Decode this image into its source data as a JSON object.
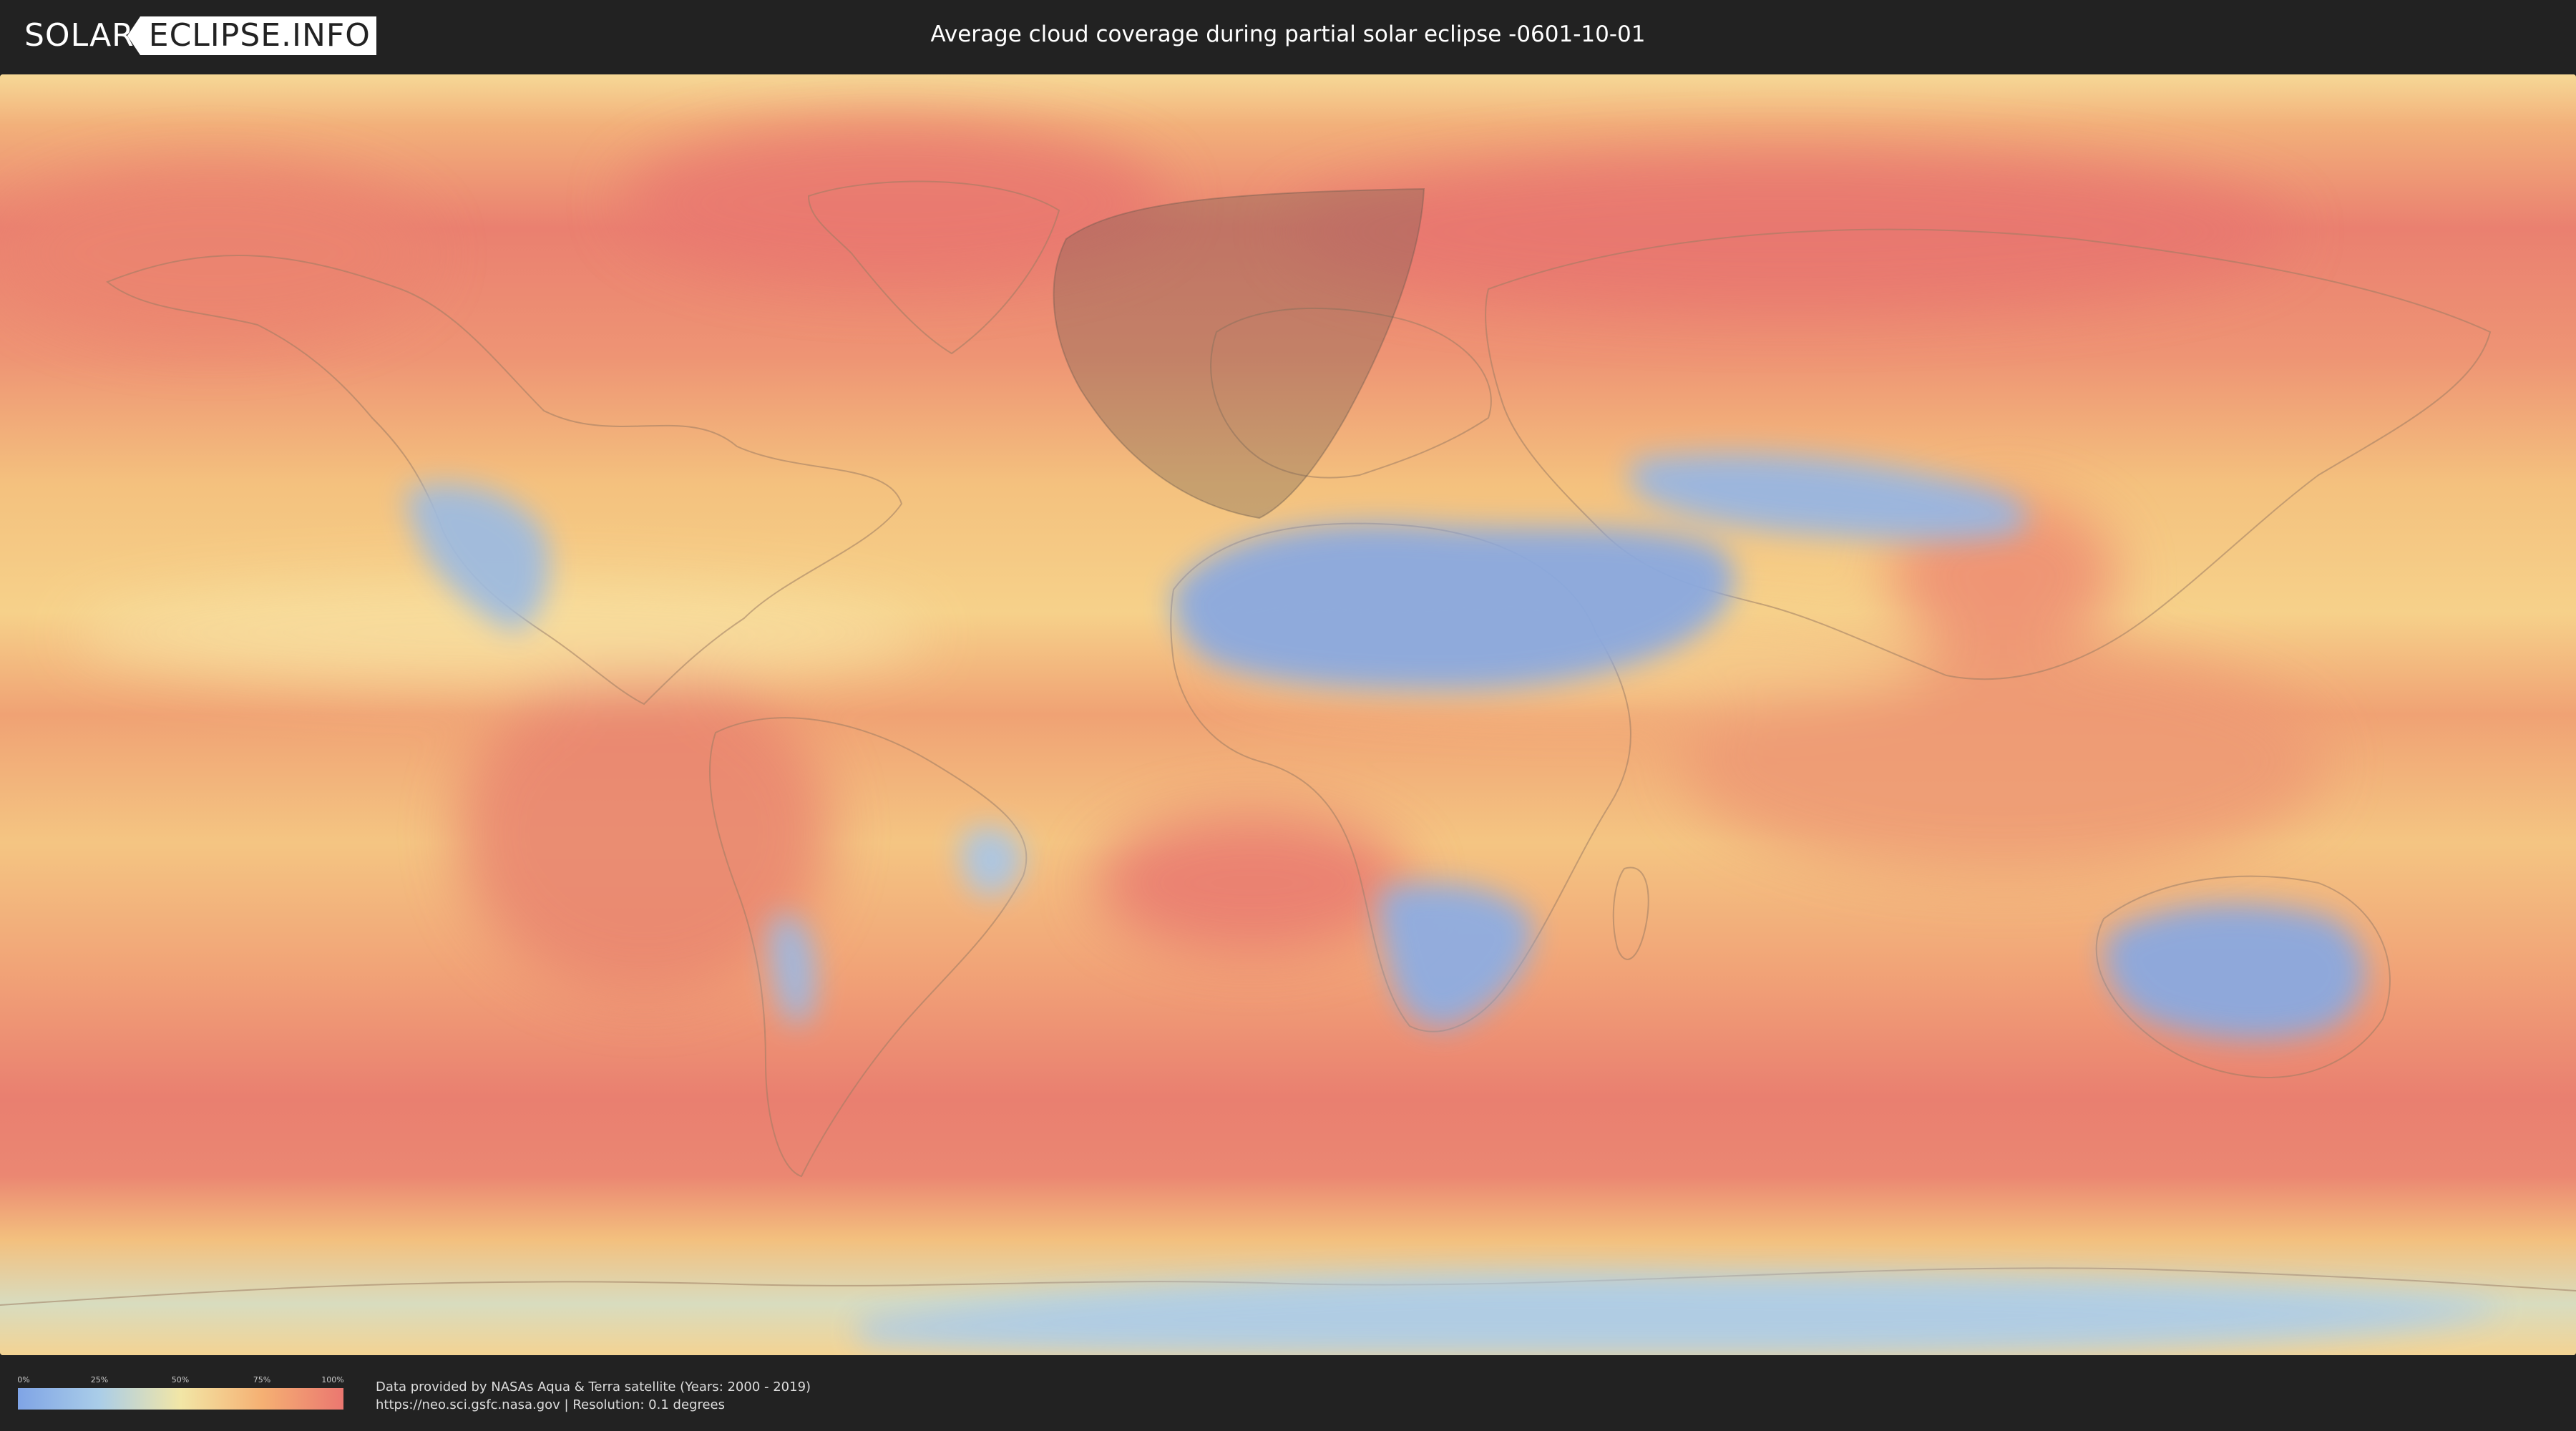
{
  "header": {
    "logo_left": "SOLAR",
    "logo_right": "ECLIPSE.INFO",
    "title": "Average cloud coverage during partial solar eclipse -0601-10-01"
  },
  "legend": {
    "ticks": [
      "0%",
      "25%",
      "50%",
      "75%",
      "100%"
    ],
    "colors": [
      "#7fa4e6",
      "#aacde8",
      "#f2e6a6",
      "#f5b073",
      "#eb7770"
    ]
  },
  "credits": {
    "line1": "Data provided by NASAs Aqua & Terra satellite (Years: 2000 - 2019)",
    "line2": "https://neo.sci.gsfc.nasa.gov | Resolution: 0.1 degrees"
  },
  "map": {
    "projection": "equirectangular",
    "eclipse_zone": "partial eclipse visibility region over the North Atlantic / Europe, shaded dark"
  }
}
